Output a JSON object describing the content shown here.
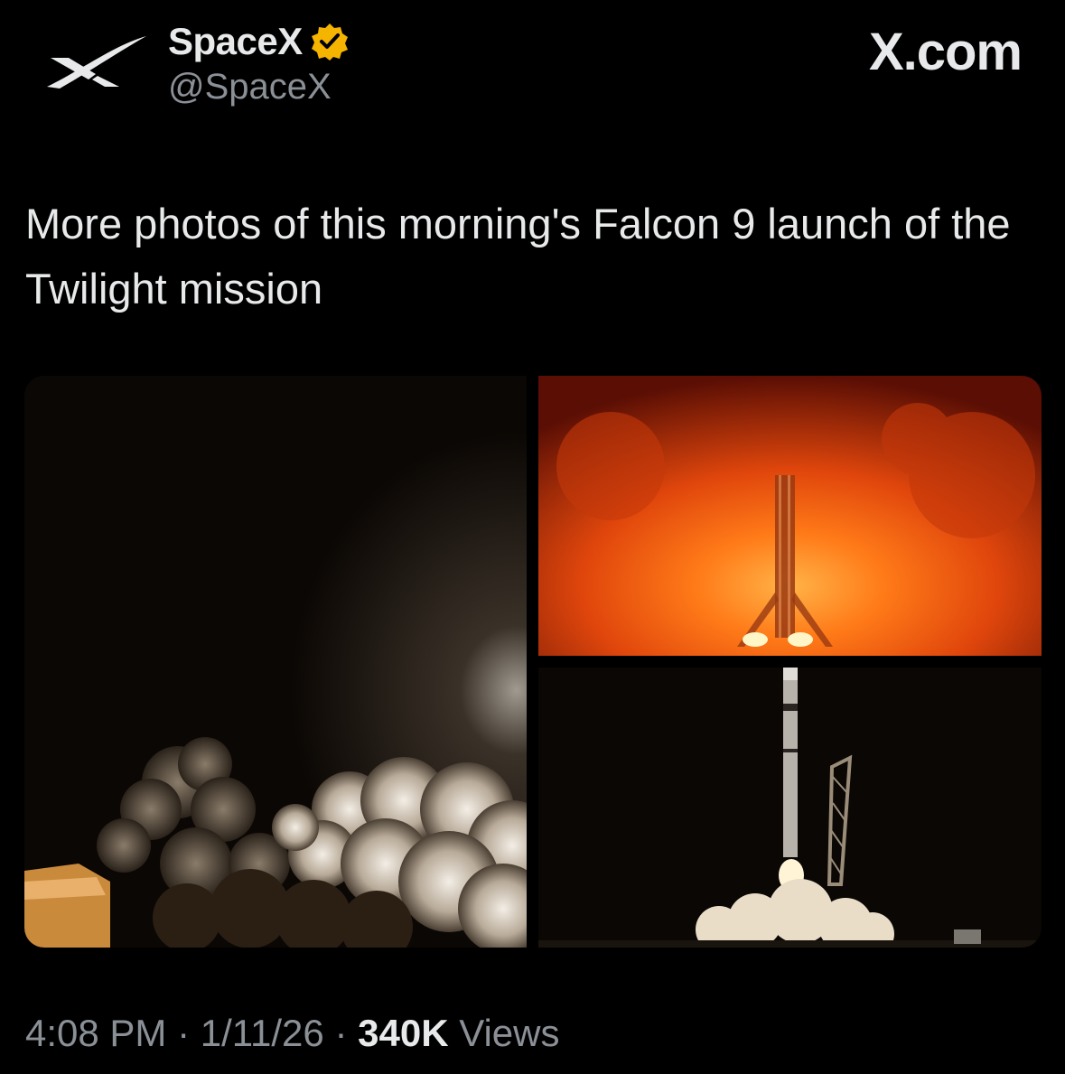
{
  "author": {
    "display_name": "SpaceX",
    "handle": "@SpaceX",
    "avatar_icon": "spacex-x-logo",
    "verified_icon": "verified-badge-icon",
    "verified_color": "#f4b400"
  },
  "site_label": "X.com",
  "tweet": {
    "text": "More photos of this morning's Falcon 9 launch of the Twilight mission"
  },
  "media": {
    "photos": [
      {
        "description_icon": "launch-smoke-photo"
      },
      {
        "description_icon": "rocket-engine-fire-photo"
      },
      {
        "description_icon": "rocket-liftoff-photo"
      }
    ]
  },
  "meta": {
    "time": "4:08 PM",
    "separator": "·",
    "date": "1/11/26",
    "views_count": "340K",
    "views_label": "Views"
  },
  "colors": {
    "background": "#000000",
    "text": "#e7e9ea",
    "muted": "#8b9097"
  }
}
